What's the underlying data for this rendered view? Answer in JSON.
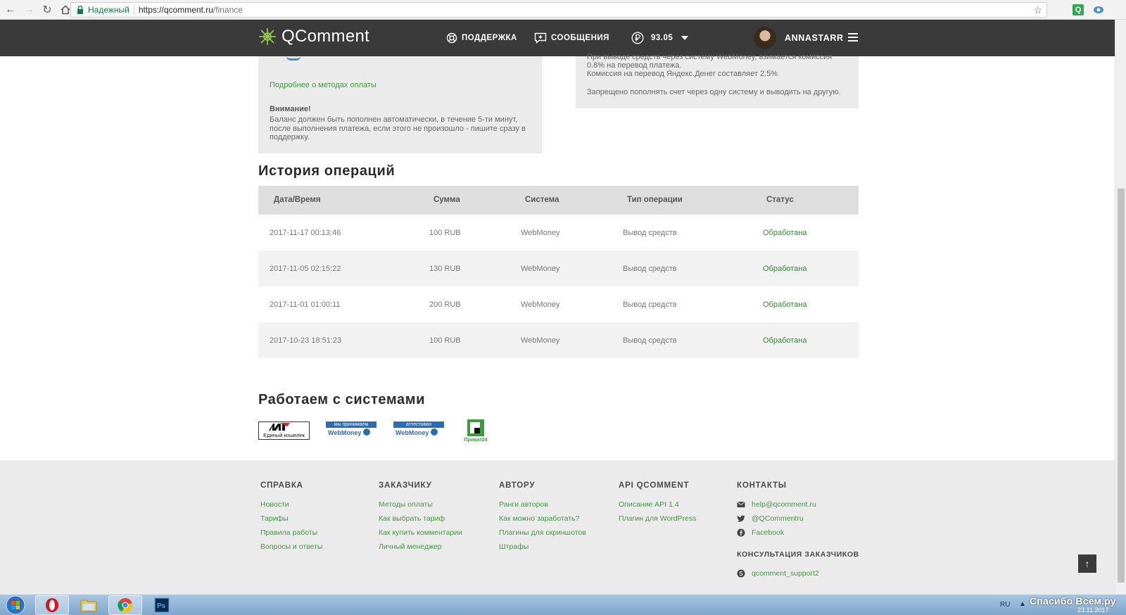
{
  "browser": {
    "secure_label": "Надежный",
    "url_host": "https://qcomment.ru",
    "url_path": "/finance"
  },
  "header": {
    "logo_text": "QComment",
    "support_label": "ПОДДЕРЖКА",
    "messages_label": "СООБЩЕНИЯ",
    "balance": "93.05",
    "username": "ANNASTARR"
  },
  "left_panel": {
    "payment_link": "Подробнее о методах оплаты",
    "warning_title": "Внимание!",
    "warning_text": "Баланс должен быть пополнен автоматически, в течение 5-ти минут, после выполнения платежа, если этого не произошло - пишите сразу в поддержку."
  },
  "right_panel": {
    "line1": "При выводе средств через систему WebMoney, взимается комиссия",
    "line2": "0.8% на перевод платежа.",
    "line3": "Комиссия на перевод Яндекс.Денег составляет 2.5%",
    "line4": "Запрещено пополнять счет через одну систему и выводить на другую."
  },
  "history": {
    "title": "История операций",
    "columns": [
      "Дата/Время",
      "Сумма",
      "Система",
      "Тип операции",
      "Статус"
    ],
    "rows": [
      {
        "datetime": "2017-11-17 00:13:46",
        "amount": "100 RUB",
        "system": "WebMoney",
        "type": "Вывод средств",
        "status": "Обработана"
      },
      {
        "datetime": "2017-11-05 02:15:22",
        "amount": "130 RUB",
        "system": "WebMoney",
        "type": "Вывод средств",
        "status": "Обработана"
      },
      {
        "datetime": "2017-11-01 01:00:11",
        "amount": "200 RUB",
        "system": "WebMoney",
        "type": "Вывод средств",
        "status": "Обработана"
      },
      {
        "datetime": "2017-10-23 18:51:23",
        "amount": "100 RUB",
        "system": "WebMoney",
        "type": "Вывод средств",
        "status": "Обработана"
      }
    ]
  },
  "systems": {
    "title": "Работаем с системами",
    "logos": {
      "w1": "Единый кошелек",
      "wm_accept_top": "мы принимаем",
      "wm_accept_bottom": "WebMoney",
      "wm_attest_top": "аттестован",
      "wm_attest_bottom": "WebMoney",
      "privat": "Приват24"
    }
  },
  "footer": {
    "help": {
      "title": "СПРАВКА",
      "links": [
        "Новости",
        "Тарифы",
        "Правила работы",
        "Вопросы и ответы"
      ]
    },
    "customer": {
      "title": "ЗАКАЗЧИКУ",
      "links": [
        "Методы оплаты",
        "Как выбрать тариф",
        "Как купить комментарии",
        "Личный менеджер"
      ]
    },
    "author": {
      "title": "АВТОРУ",
      "links": [
        "Ранги авторов",
        "Как можно заработать?",
        "Плагины для скриншотов",
        "Штрафы"
      ]
    },
    "api": {
      "title": "API QCOMMENT",
      "links": [
        "Описание API 1.4",
        "Плагин для WordPress"
      ]
    },
    "contacts": {
      "title": "КОНТАКТЫ",
      "email": "help@qcomment.ru",
      "twitter": "@QCommentru",
      "facebook": "Facebook",
      "consult_title": "КОНСУЛЬТАЦИЯ ЗАКАЗЧИКОВ",
      "skype": "qcomment_support2"
    },
    "to_top": "↑"
  },
  "taskbar": {
    "lang": "RU",
    "watermark": "Спасибо Всем.ру",
    "date": "23.11.2017"
  },
  "colors": {
    "header_bg": "#3a3a3a",
    "link_green": "#3f9b3f",
    "panel_bg": "#ebebeb",
    "table_head_bg": "#dedede"
  }
}
